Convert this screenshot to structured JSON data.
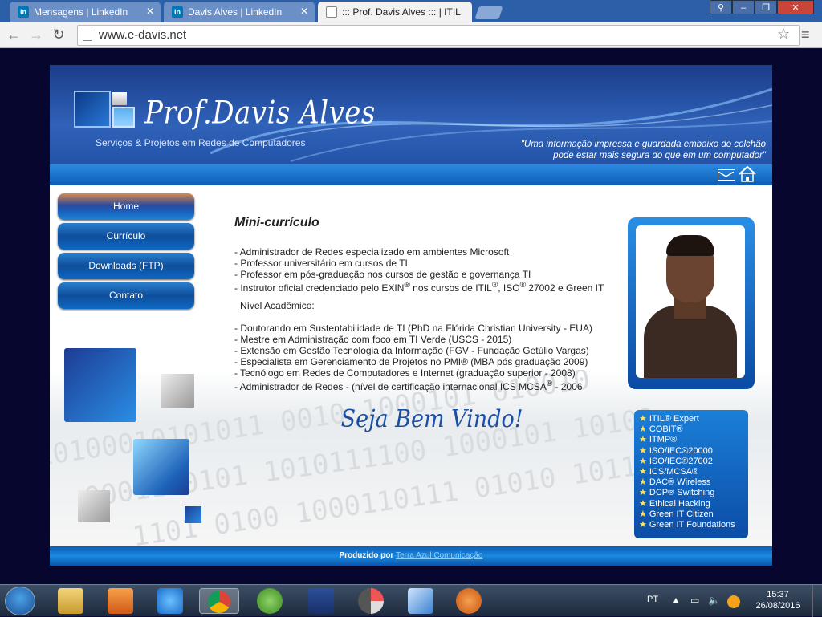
{
  "browser": {
    "tabs": [
      {
        "label": "Mensagens | LinkedIn",
        "icon": "in"
      },
      {
        "label": "Davis Alves | LinkedIn",
        "icon": "in"
      },
      {
        "label": "::: Prof. Davis Alves ::: | ITIL",
        "icon": "doc"
      }
    ],
    "url": "www.e-davis.net"
  },
  "site": {
    "logo": "Prof.Davis Alves",
    "subtitle": "Serviços & Projetos em Redes de Computadores",
    "quote_line1": "\"Uma informação impressa e guardada embaixo do colchão",
    "quote_line2": "pode estar mais segura do que em um computador\"",
    "menu": [
      "Home",
      "Currículo",
      "Downloads (FTP)",
      "Contato"
    ],
    "heading": "Mini-currículo",
    "items1": [
      "- Administrador de Redes especializado em ambientes Microsoft",
      "- Professor universitário em cursos de TI",
      "- Professor em pós-graduação nos cursos de gestão e governança TI"
    ],
    "item_exin": {
      "pre": "- Instrutor oficial credenciado pelo EXIN",
      "mid1": " nos cursos de ITIL",
      "mid2": ", ISO",
      "post": " 27002 e Green IT",
      "reg": "®"
    },
    "academic_label": "Nível Acadêmico:",
    "items2": [
      "- Doutorando em Sustentabilidade de TI (PhD na Flórida Christian University - EUA)",
      "- Mestre em Administração com foco em TI Verde (USCS - 2015)",
      "- Extensão em Gestão Tecnologia da Informação (FGV - Fundação Getúlio Vargas)",
      "- Especialista em Gerenciamento de Projetos no PMI® (MBA pós graduação 2009)",
      "- Tecnólogo em Redes de Computadores e Internet (graduação superior - 2008)"
    ],
    "item_last": {
      "pre": "- Administrador de Redes - (nível de certificação internacional ICS MCSA",
      "reg": "®",
      "post": " - 2006"
    },
    "welcome": "Seja Bem Vindo!",
    "certs": [
      "ITIL® Expert",
      "COBIT®",
      "ITMP®",
      "ISO/IEC®20000",
      "ISO/IEC®27002",
      "ICS/MCSA®",
      "DAC® Wireless",
      "DCP® Switching",
      "Ethical Hacking",
      "Green IT Citizen",
      "Green IT Foundations"
    ],
    "footer_pre": "Produzido por",
    "footer_link": "Terra Azul Comunicação"
  },
  "taskbar": {
    "lang": "PT",
    "time": "15:37",
    "date": "26/08/2016"
  }
}
